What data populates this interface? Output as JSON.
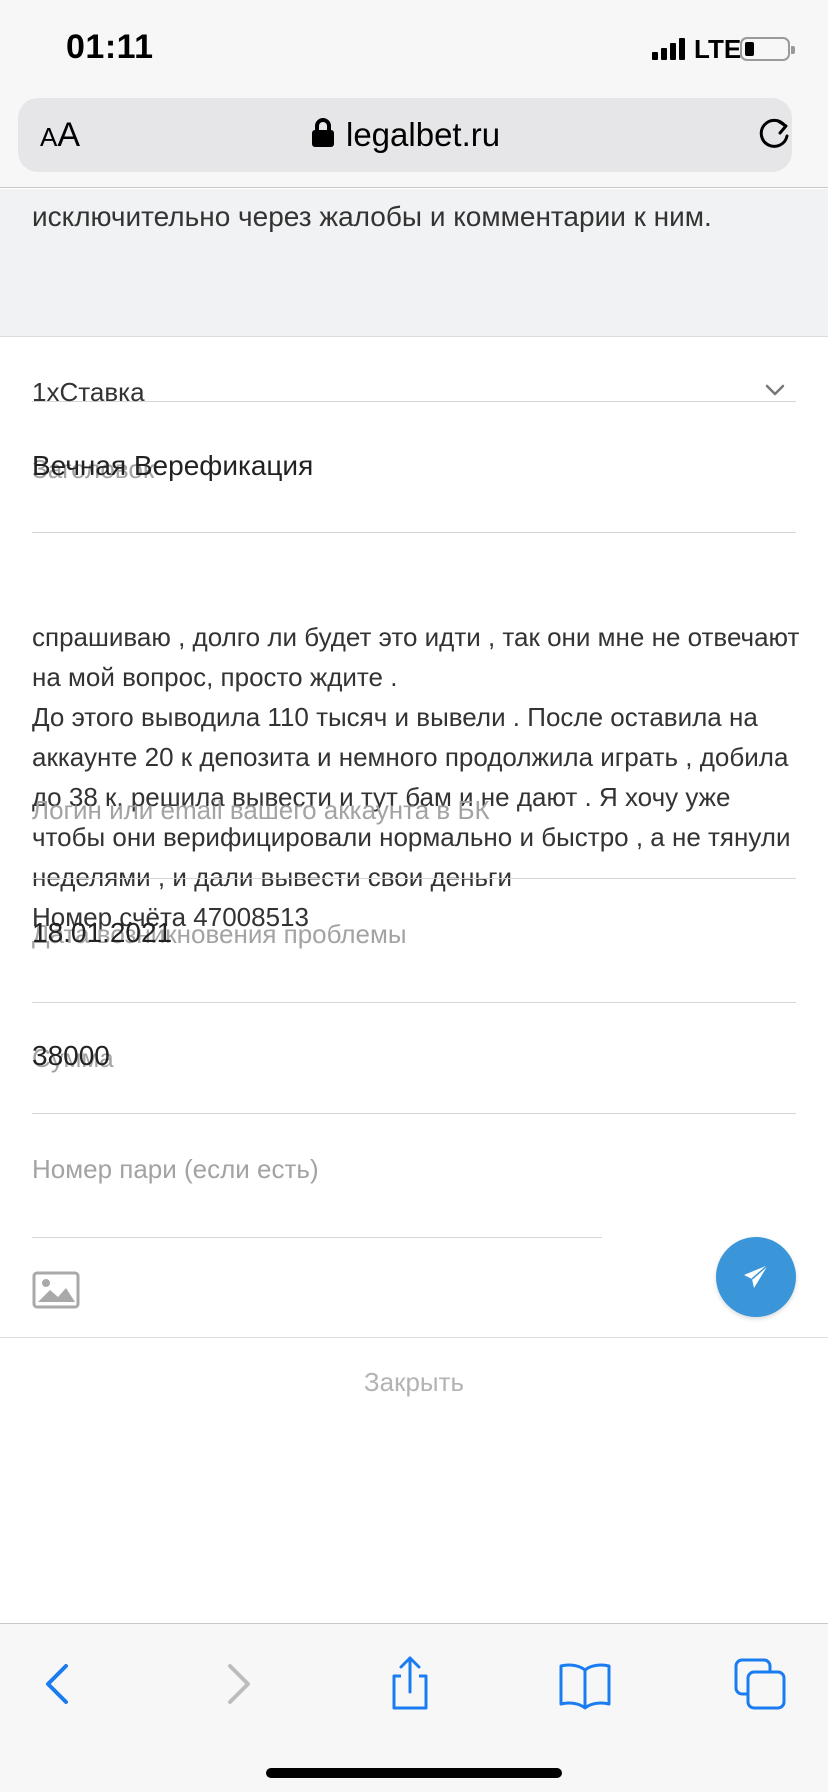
{
  "status_bar": {
    "time": "01:11",
    "network": "LTE"
  },
  "address_bar": {
    "text_size_small": "A",
    "text_size_big": "A",
    "url": "legalbet.ru"
  },
  "info": {
    "text": "менеджерам, так как вся коммуникация строится исключительно через жалобы и комментарии к ним."
  },
  "form": {
    "bookmaker": "1хСтавка",
    "title_placeholder": "Заголовок",
    "title_value": "Вечная Верефикация",
    "body_text": "спрашиваю , долго ли будет это идти , так они мне не отвечают на мой вопрос, просто ждите .\nДо этого выводила 110 тысяч и вывели . После оставила на аккаунте 20 к депозита и немного продолжила играть , добила до 38 к, решила вывести и тут бам и не дают . Я хочу уже чтобы они верифицировали нормально и быстро , а не тянули неделями , и дали вывести свои деньги\nНомер счёта 47008513",
    "login_placeholder": "Логин или email вашего аккаунта в БК",
    "date_placeholder": "Дата возникновения проблемы",
    "date_value": "18.01.2021",
    "sum_placeholder": "Сумма",
    "sum_value": "38000",
    "bet_placeholder": "Номер пари (если есть)",
    "close_label": "Закрыть"
  },
  "colors": {
    "accent": "#3a96d9",
    "toolbar_icon": "#1a7cf0",
    "toolbar_icon_disabled": "#bdbdbd"
  }
}
